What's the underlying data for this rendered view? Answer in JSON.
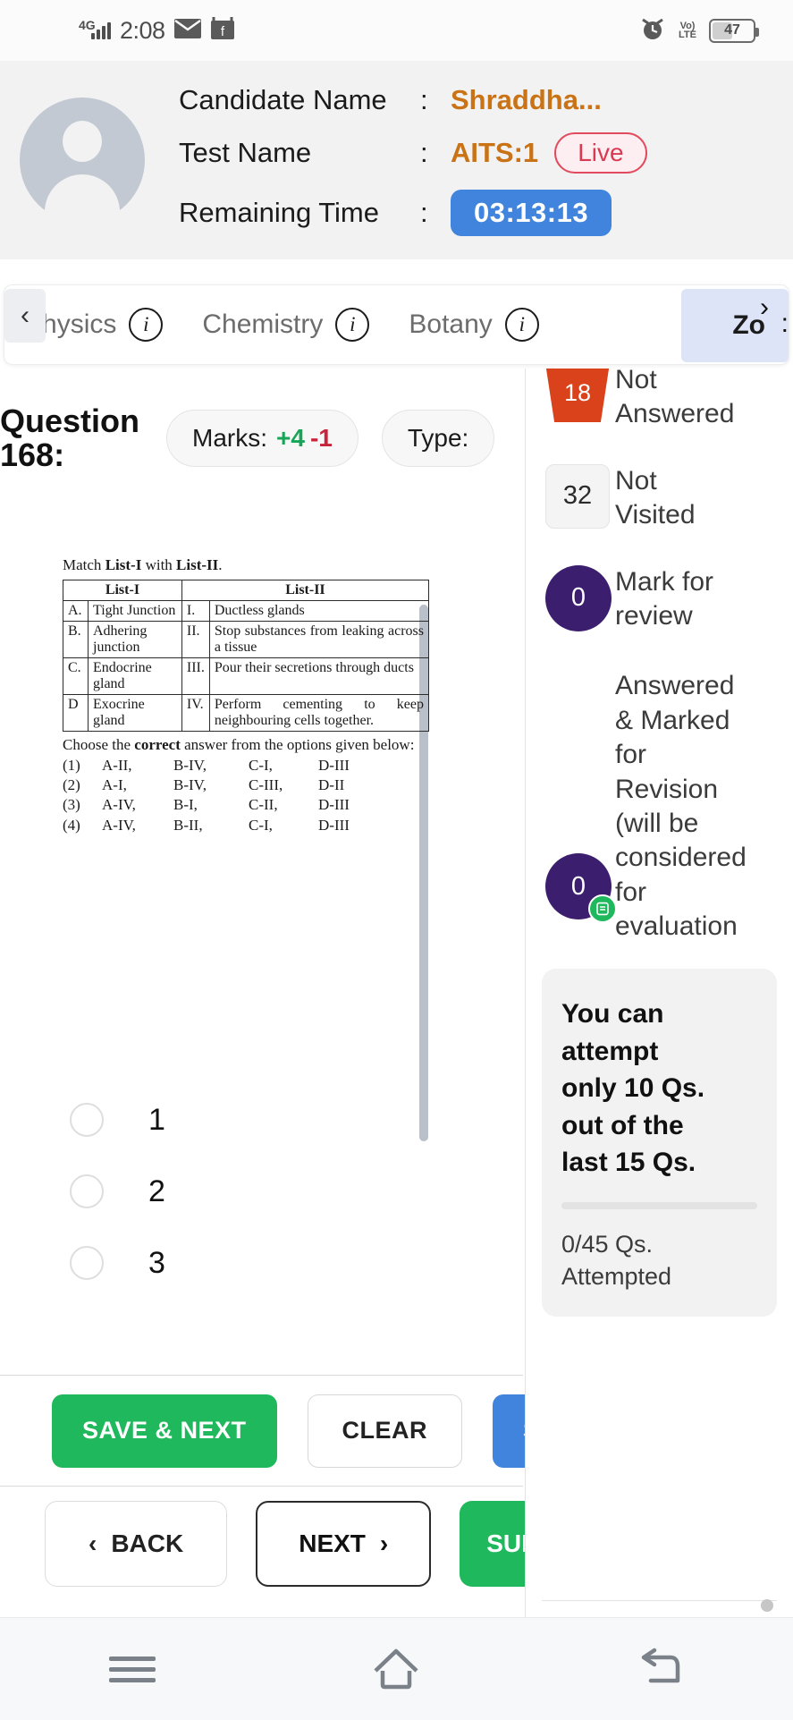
{
  "status_bar": {
    "network": "4G",
    "time": "2:08",
    "icons": [
      "mail-icon",
      "app-icon"
    ],
    "alarm_icon": "alarm-icon",
    "volte_line1": "Vo)",
    "volte_line2": "LTE",
    "battery": "47"
  },
  "header": {
    "rows": [
      {
        "label": "Candidate Name",
        "colon": ":",
        "value": "Shraddha..."
      },
      {
        "label": "Test Name",
        "colon": ":",
        "value": "AITS:1",
        "badge": "Live"
      },
      {
        "label": "Remaining Time",
        "colon": ":",
        "value": "03:13:13"
      }
    ],
    "accent_orange": "#c97316",
    "live_color": "#d93a52",
    "timer_bg": "#4084dd"
  },
  "tabs": {
    "prev_arrow": "‹",
    "next_arrow": "›",
    "items": [
      {
        "label": "Physics",
        "info": "i",
        "active": false
      },
      {
        "label": "Chemistry",
        "info": "i",
        "active": false
      },
      {
        "label": "Botany",
        "info": "i",
        "active": false
      },
      {
        "label": "Zo",
        "info": "",
        "active": true
      }
    ],
    "trailing_colon": ":"
  },
  "question_meta": {
    "title_line1": "Question",
    "title_line2": "168:",
    "marks_label": "Marks:",
    "marks_positive": "+4",
    "marks_negative": "-1",
    "type_label": "Type:"
  },
  "question_body": {
    "lead_prefix": "Match ",
    "lead_bold1": "List-I",
    "lead_mid": " with ",
    "lead_bold2": "List-II",
    "lead_suffix": ".",
    "table": {
      "headers": [
        "List-I",
        "List-II"
      ],
      "rows": [
        {
          "k1": "A.",
          "v1": "Tight Junction",
          "k2": "I.",
          "v2": "Ductless glands"
        },
        {
          "k1": "B.",
          "v1": "Adhering junction",
          "k2": "II.",
          "v2": "Stop substances from leaking across a tissue"
        },
        {
          "k1": "C.",
          "v1": "Endocrine gland",
          "k2": "III.",
          "v2": "Pour their secretions through ducts"
        },
        {
          "k1": "D",
          "v1": "Exocrine gland",
          "k2": "IV.",
          "v2": "Perform cementing to keep neighbouring cells together."
        }
      ]
    },
    "choose_prefix": "Choose the ",
    "choose_bold": "correct",
    "choose_suffix": " answer from the options given below:",
    "options": [
      {
        "n": "(1)",
        "a": "A-II,",
        "b": "B-IV,",
        "c": "C-I,",
        "d": "D-III"
      },
      {
        "n": "(2)",
        "a": "A-I,",
        "b": "B-IV,",
        "c": "C-III,",
        "d": "D-II"
      },
      {
        "n": "(3)",
        "a": "A-IV,",
        "b": "B-I,",
        "c": "C-II,",
        "d": "D-III"
      },
      {
        "n": "(4)",
        "a": "A-IV,",
        "b": "B-II,",
        "c": "C-I,",
        "d": "D-III"
      }
    ]
  },
  "answer_options": [
    {
      "value": "1",
      "selected": false
    },
    {
      "value": "2",
      "selected": false
    },
    {
      "value": "3",
      "selected": false
    }
  ],
  "actions": {
    "save_next": "SAVE & NEXT",
    "clear": "CLEAR",
    "save_blue": "SA",
    "back": "BACK",
    "back_arrow": "‹",
    "next": "NEXT",
    "next_arrow": "›",
    "submit": "SUB"
  },
  "legend": [
    {
      "count": "18",
      "label_line1": "Not",
      "label_line2": "Answered",
      "shape": "trapezoid",
      "color": "#d9421b"
    },
    {
      "count": "32",
      "label_line1": "Not",
      "label_line2": "Visited",
      "shape": "square",
      "color": "#f4f4f4"
    },
    {
      "count": "0",
      "label_line1": "Mark for",
      "label_line2": "review",
      "shape": "circle",
      "color": "#3c1e6e"
    },
    {
      "count": "0",
      "label_line1": "Answered",
      "label_line2": "& Marked",
      "label_line3": "for",
      "label_line4": "Revision",
      "label_line5": "(will be",
      "label_line6": "considered",
      "label_line7": "for",
      "label_line8": "evaluation",
      "shape": "circle-tick",
      "color": "#3c1e6e",
      "tick_color": "#20b85c"
    }
  ],
  "info_card": {
    "line1": "You can",
    "line2": "attempt",
    "line3": "only 10 Qs.",
    "line4": "out of the",
    "line5": "last 15 Qs.",
    "attempted_line1": "0/45 Qs.",
    "attempted_line2": "Attempted"
  },
  "nav_bar": {
    "recents": "menu-icon",
    "home": "home-icon",
    "back": "back-icon"
  }
}
